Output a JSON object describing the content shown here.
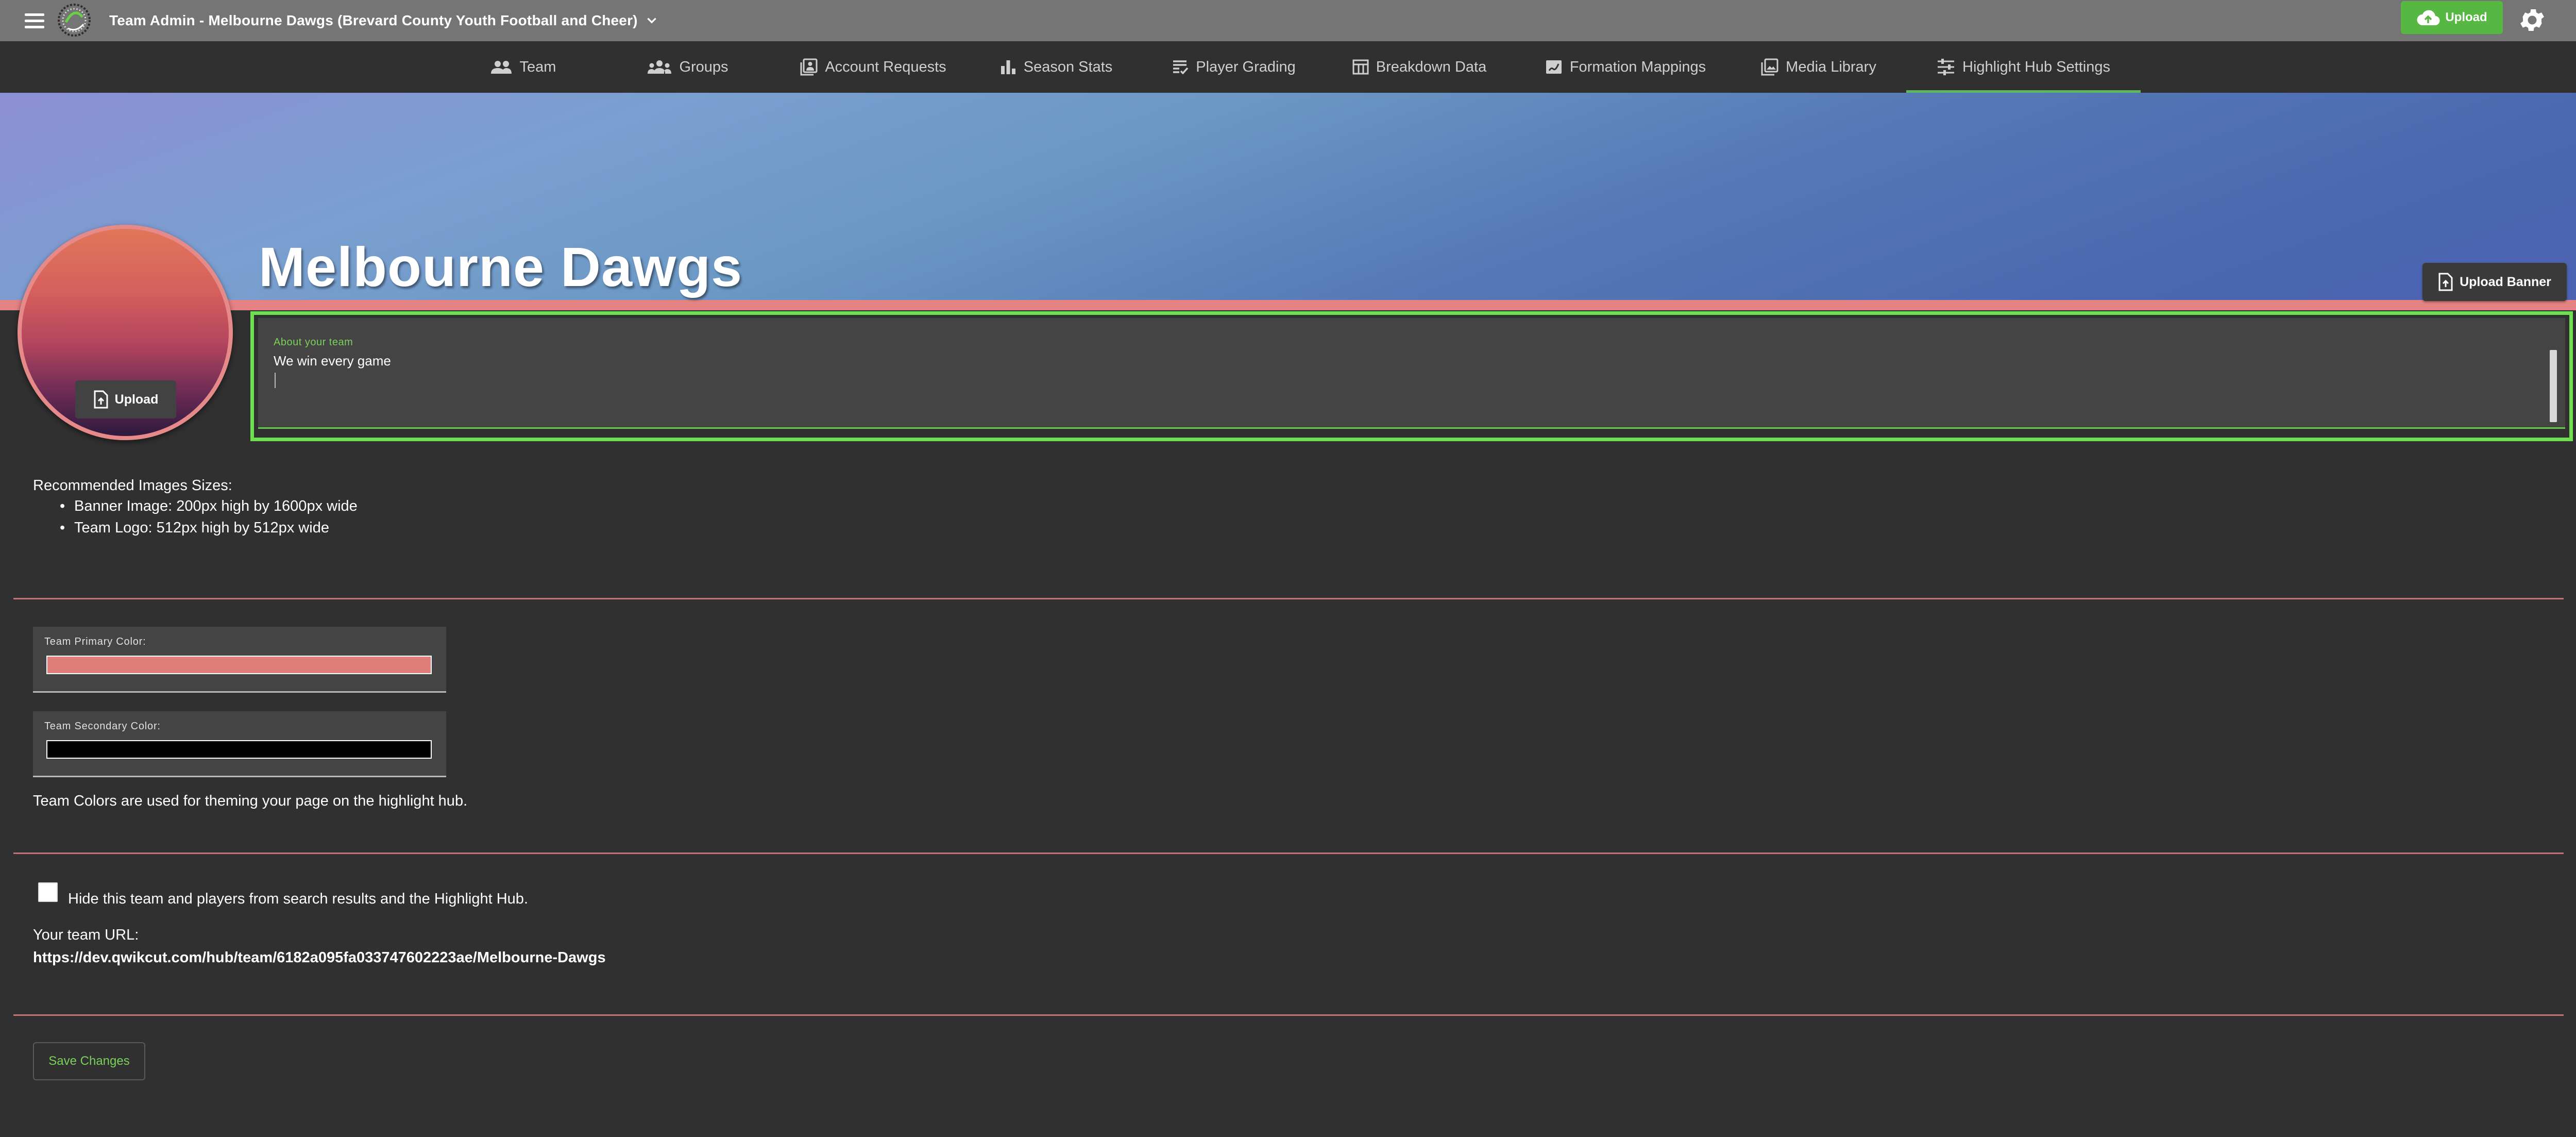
{
  "header": {
    "team_selector": "Team Admin - Melbourne Dawgs (Brevard County Youth Football and Cheer)",
    "upload_label": "Upload",
    "accent_color": "#56b742"
  },
  "tabs": [
    {
      "label": "Team",
      "icon": "people-icon"
    },
    {
      "label": "Groups",
      "icon": "groups-icon"
    },
    {
      "label": "Account Requests",
      "icon": "account-box-icon"
    },
    {
      "label": "Season Stats",
      "icon": "bar-chart-icon"
    },
    {
      "label": "Player Grading",
      "icon": "grading-list-icon"
    },
    {
      "label": "Breakdown Data",
      "icon": "table-icon"
    },
    {
      "label": "Formation Mappings",
      "icon": "draw-icon"
    },
    {
      "label": "Media Library",
      "icon": "photo-library-icon"
    },
    {
      "label": "Highlight Hub Settings",
      "icon": "tune-icon",
      "active": true
    }
  ],
  "banner": {
    "team_name": "Melbourne Dawgs",
    "upload_banner_label": "Upload Banner",
    "logo_upload_label": "Upload"
  },
  "about": {
    "label": "About your team",
    "value": "We win every game"
  },
  "recommendations": {
    "title": "Recommended Images Sizes:",
    "items": [
      "Banner Image: 200px high by 1600px wide",
      "Team Logo: 512px high by 512px wide"
    ]
  },
  "colors": {
    "primary_label": "Team Primary Color:",
    "primary_value": "#e07e7c",
    "secondary_label": "Team Secondary Color:",
    "secondary_value": "#000000",
    "note": "Team Colors are used for theming your page on the highlight hub."
  },
  "visibility": {
    "hide_label": "Hide this team and players from search results and the Highlight Hub.",
    "hide_checked": false,
    "url_label": "Your team URL:",
    "url_value": "https://dev.qwikcut.com/hub/team/6182a095fa033747602223ae/Melbourne-Dawgs"
  },
  "actions": {
    "save_label": "Save Changes"
  }
}
